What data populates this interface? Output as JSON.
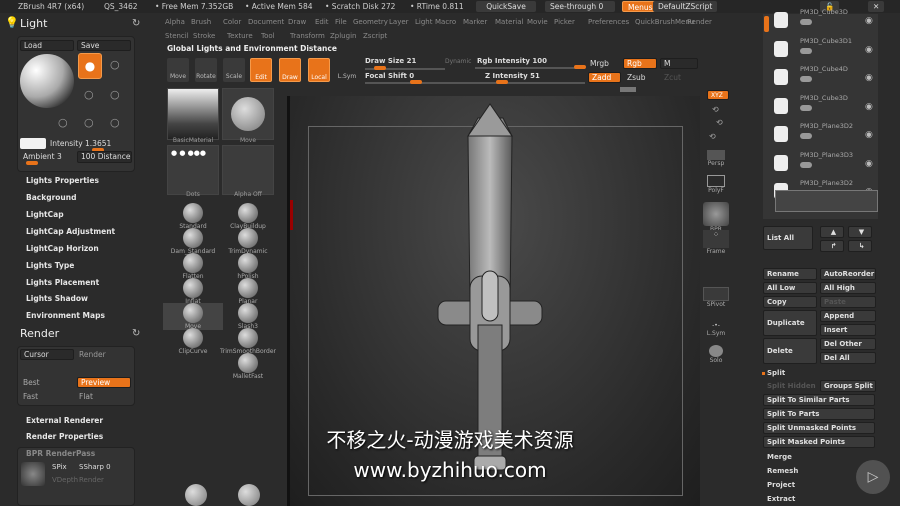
{
  "titlebar": {
    "app": "ZBrush 4R7 (x64)",
    "doc": "QS_3462",
    "free_mem": "• Free Mem 7.352GB",
    "active_mem": "• Active Mem 584",
    "scratch": "• Scratch Disk 272",
    "rtime": "• RTime 0.811",
    "quicksave": "QuickSave",
    "seethrough": "See-through  0",
    "menus": "Menus",
    "defaultzscript": "DefaultZScript"
  },
  "menu_row1": [
    "Alpha",
    "Brush",
    "Color",
    "Document",
    "Draw",
    "Edit",
    "File",
    "Geometry",
    "Layer",
    "Light",
    "Macro",
    "Marker",
    "Material",
    "Movie",
    "Picker",
    "Preferences",
    "QuickBrushMenu",
    "Render"
  ],
  "menu_row2": [
    "Stencil",
    "Stroke",
    "Texture",
    "Tool",
    "Transform",
    "Zplugin",
    "Zscript"
  ],
  "tooltip_title": "Global Lights and Environment Distance",
  "toolbar": {
    "move": "Move",
    "rotate": "Rotate",
    "scale": "Scale",
    "edit": "Edit",
    "draw": "Draw",
    "local": "Local",
    "lsym": "L.Sym",
    "draw_size": "Draw Size 21",
    "focal_shift": "Focal Shift 0",
    "dynamic": "Dynamic",
    "rgb_intensity": "Rgb Intensity 100",
    "z_intensity": "Z Intensity 51",
    "mrgb": "Mrgb",
    "rgb": "Rgb",
    "m": "M",
    "zadd": "Zadd",
    "zsub": "Zsub",
    "zcut": "Zcut"
  },
  "light": {
    "title": "Light",
    "load": "Load",
    "save": "Save",
    "intensity": "Intensity 1.3651",
    "ambient": "Ambient 3",
    "distance": "100 Distance",
    "items": [
      "Lights Properties",
      "Background",
      "LightCap",
      "LightCap Adjustment",
      "LightCap Horizon",
      "Lights Type",
      "Lights Placement",
      "Lights Shadow",
      "Environment Maps"
    ]
  },
  "render": {
    "title": "Render",
    "cursor": "Cursor",
    "render": "Render",
    "best": "Best",
    "preview": "Preview",
    "fast": "Fast",
    "flat": "Flat",
    "external": "External Renderer",
    "properties": "Render Properties",
    "bpr": "BPR RenderPass",
    "spix": "SPix",
    "ssharp": "SSharp 0",
    "vdepth": "VDepth",
    "render_label": "Render"
  },
  "brush_palette": {
    "material": "BasicMaterial",
    "move_tile": "Move",
    "dots": "Dots",
    "alpha_off": "Alpha Off",
    "brushes": [
      "Standard",
      "ClayBuildup",
      "Dam_Standard",
      "TrimDynamic",
      "Flatten",
      "hPolish",
      "Inflat",
      "Planar",
      "Move",
      "Slash3",
      "ClipCurve",
      "TrimSmoothBorder",
      "MalletFast"
    ]
  },
  "shelf": {
    "xyz": "XYZ",
    "persp": "Persp",
    "polyf": "PolyF",
    "bpr": "BPR",
    "frame": "Frame",
    "spivot": "SPivot",
    "lsym": "L.Sym",
    "solo": "Solo"
  },
  "subtools": [
    "PM3D_Cube3D",
    "PM3D_Cube3D1",
    "PM3D_Cube4D",
    "PM3D_Cube3D",
    "PM3D_Plane3D2",
    "PM3D_Plane3D3",
    "PM3D_Plane3D2"
  ],
  "subtool_buttons": {
    "list_all": "List All",
    "rename": "Rename",
    "autoreorder": "AutoReorder",
    "all_low": "All Low",
    "all_high": "All High",
    "copy": "Copy",
    "paste": "Paste",
    "duplicate": "Duplicate",
    "append": "Append",
    "insert": "Insert",
    "delete": "Delete",
    "del_other": "Del Other",
    "del_all": "Del All",
    "split": "Split",
    "split_hidden": "Split Hidden",
    "groups_split": "Groups Split",
    "split_similar": "Split To Similar Parts",
    "split_parts": "Split To Parts",
    "split_unmasked": "Split Unmasked Points",
    "split_masked": "Split Masked Points",
    "merge": "Merge",
    "remesh": "Remesh",
    "project": "Project",
    "extract": "Extract"
  },
  "watermark": {
    "line1": "不移之火-动漫游戏美术资源",
    "line2": "www.byzhihuo.com"
  },
  "colors": {
    "accent": "#e8731a",
    "bg": "#2b2b2b"
  }
}
